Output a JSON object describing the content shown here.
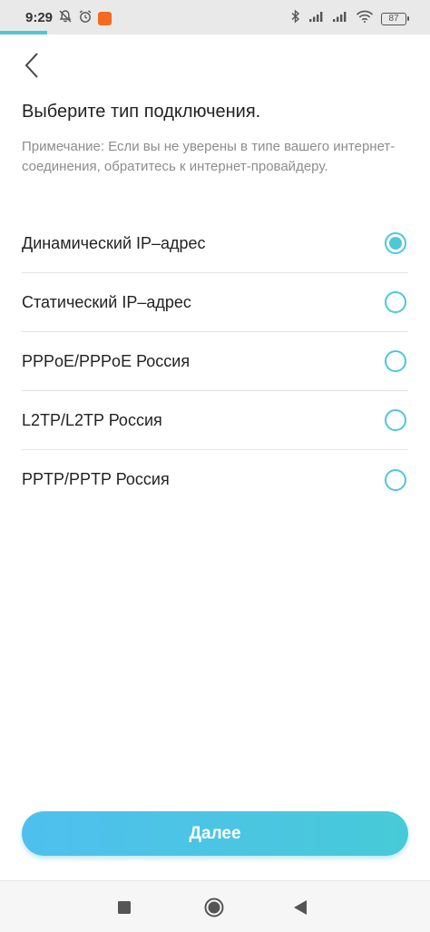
{
  "status_bar": {
    "time": "9:29",
    "battery": "87",
    "icons_left": [
      "mute-icon",
      "alarm-icon",
      "app-badge-icon"
    ],
    "icons_right": [
      "bluetooth-icon",
      "signal-icon",
      "signal-icon",
      "wifi-icon",
      "battery-icon"
    ]
  },
  "progress": {
    "fraction": 0.11
  },
  "header": {
    "title": "Выберите тип подключения.",
    "note": "Примечание: Если вы не уверены в типе вашего интернет-соединения, обратитесь к интернет-провайдеру."
  },
  "options": [
    {
      "label": "Динамический IP–адрес",
      "selected": true
    },
    {
      "label": "Статический IP–адрес",
      "selected": false
    },
    {
      "label": "PPPoE/PPPoE Россия",
      "selected": false
    },
    {
      "label": "L2TP/L2TP Россия",
      "selected": false
    },
    {
      "label": "PPTP/PPTP Россия",
      "selected": false
    }
  ],
  "actions": {
    "next_label": "Далее"
  },
  "colors": {
    "accent": "#4ec7d9",
    "button_start": "#4fc0ee",
    "button_end": "#47cad8",
    "note_text": "#8d8d8d"
  }
}
